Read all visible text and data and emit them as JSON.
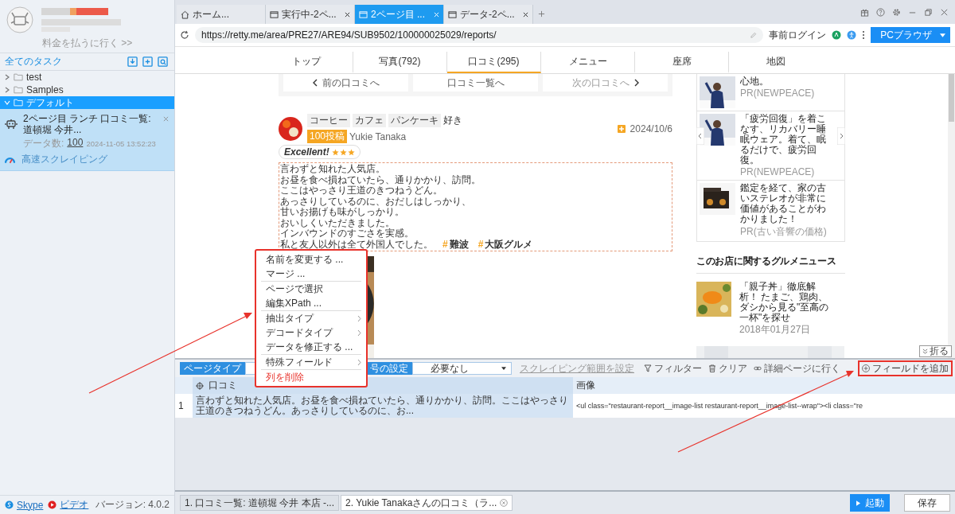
{
  "sidebar": {
    "pay_link": "料金を払うに行く >>",
    "tasks_title": "全てのタスク",
    "folders": [
      {
        "label": "test",
        "expanded": false,
        "selected": false
      },
      {
        "label": "Samples",
        "expanded": false,
        "selected": false
      },
      {
        "label": "デフォルト",
        "expanded": true,
        "selected": true,
        "children": [
          {
            "title": "2ページ目 ランチ 口コミ一覧: 道頓堀 今井...",
            "data_label": "データ数:",
            "data_count": "100",
            "time": "2024-11-05 13:52:23",
            "mode": "高速スクレイピング"
          }
        ]
      }
    ],
    "footer_links": [
      "Skype",
      "ビデオ"
    ],
    "version": "バージョン: 4.0.2"
  },
  "browser_tabs": [
    {
      "kind": "home",
      "label": "ホーム...",
      "selected": false,
      "closable": false
    },
    {
      "kind": "page",
      "label": "実行中-2ペ...",
      "selected": false,
      "closable": true
    },
    {
      "kind": "page",
      "label": "2ページ目 ...",
      "selected": true,
      "closable": true
    },
    {
      "kind": "page",
      "label": "データ-2ペ...",
      "selected": false,
      "closable": true
    }
  ],
  "address_bar": {
    "url": "https://retty.me/area/PRE27/ARE94/SUB9502/100000025029/reports/",
    "login": "事前ログイン",
    "browser_mode": "PCブラウザ"
  },
  "site_nav": [
    {
      "label": "トップ",
      "selected": false
    },
    {
      "label": "写真(792)",
      "selected": false
    },
    {
      "label": "口コミ(295)",
      "selected": true
    },
    {
      "label": "メニュー",
      "selected": false
    },
    {
      "label": "座席",
      "selected": false
    },
    {
      "label": "地図",
      "selected": false
    }
  ],
  "review_nav": [
    "前の口コミへ",
    "口コミ一覧へ",
    "次の口コミへ"
  ],
  "review": {
    "tags": [
      "コーヒー",
      "カフェ",
      "パンケーキ"
    ],
    "tags_suffix": "好き",
    "badge": "100投稿",
    "user": "Yukie Tanaka",
    "date": "2024/10/6",
    "rating": "Excellent!",
    "stars": 3,
    "lines": [
      "言わずと知れた人気店。",
      "お昼を食べ損ねていたら、通りかかり、訪問。",
      "ここはやっさり王道のきつねうどん。",
      "あっさりしているのに、おだしはしっかり、",
      "甘いお揚げも味がしっかり。",
      "おいしくいただきました。",
      "インバウンドのすごさを実感。"
    ],
    "last_line": "私と友人以外は全て外国人でした。",
    "hashtags": [
      {
        "mark": "#",
        "label": "難波"
      },
      {
        "mark": "#",
        "label": "大阪グルメ"
      }
    ]
  },
  "ads": [
    {
      "text": "心地。",
      "source": "PR(NEWPEACE)"
    },
    {
      "text": "「疲労回復」を着こなす、リカバリー睡眠ウェア。着て、眠るだけで、疲労回復。",
      "source": "PR(NEWPEACE)"
    },
    {
      "text": "鑑定を経て、家の古いステレオが非常に価値があることがわかりました！",
      "source": "PR(古い音響の価格)"
    }
  ],
  "news": {
    "heading": "このお店に関するグルメニュース",
    "items": [
      {
        "title": "「親子丼」徹底解析！ たまご、鶏肉、ダシから見る\"至高の一杯\"を探せ",
        "date": "2018年01月27日"
      }
    ]
  },
  "panel": {
    "page_type": "ページタイプ",
    "setting_label": "号の設定",
    "setting_value": "必要なし",
    "range_link": "スクレイピング範囲を設定",
    "tools": [
      {
        "kind": "filter",
        "label": "フィルター"
      },
      {
        "kind": "clear",
        "label": "クリア"
      },
      {
        "kind": "link",
        "label": "詳細ページに行く"
      }
    ],
    "add_field": "フィールドを追加",
    "fold": "折る"
  },
  "table": {
    "columns": [
      {
        "label": "口コミ",
        "selected": true
      },
      {
        "label": "画像",
        "selected": false
      }
    ],
    "rows": [
      {
        "index": "1",
        "cells": [
          "言わずと知れた人気店。お昼を食べ損ねていたら、通りかかり、訪問。ここはやっさり王道のきつねうどん。あっさりしているのに、お...",
          "<ul class=\"restaurant-report__image-list restaurant-report__image-list--wrap\"><li class=\"re"
        ]
      }
    ]
  },
  "context_menu": {
    "groups": [
      [
        {
          "label": "名前を変更する ...",
          "kind": "item"
        },
        {
          "label": "マージ ...",
          "kind": "item"
        }
      ],
      [
        {
          "label": "ページで選択",
          "kind": "item"
        },
        {
          "label": "編集XPath ...",
          "kind": "item"
        }
      ],
      [
        {
          "label": "抽出タイプ",
          "kind": "submenu"
        },
        {
          "label": "デコードタイプ",
          "kind": "submenu"
        },
        {
          "label": "データを修正する ...",
          "kind": "item"
        }
      ],
      [
        {
          "label": "特殊フィールド",
          "kind": "submenu"
        }
      ],
      [
        {
          "label": "列を削除",
          "kind": "danger"
        }
      ]
    ]
  },
  "job_tabs": [
    {
      "label": "1. 口コミ一覧: 道頓堀 今井 本店 -...",
      "selected": false,
      "closable": false
    },
    {
      "label": "2. Yukie Tanakaさんの口コミ（ラ...",
      "selected": true,
      "closable": true
    }
  ],
  "actions": {
    "start": "起動",
    "save": "保存"
  }
}
